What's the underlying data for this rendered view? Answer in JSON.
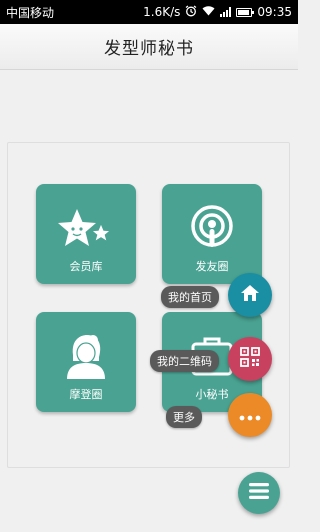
{
  "status_bar": {
    "carrier": "中国移动",
    "speed": "1.6K/s",
    "time": "09:35",
    "icons": [
      "alarm-icon",
      "wifi-icon",
      "signal-icon",
      "battery-icon"
    ]
  },
  "title_bar": {
    "title": "发型师秘书"
  },
  "tiles": [
    {
      "label": "会员库",
      "icon": "stars-icon"
    },
    {
      "label": "发友圈",
      "icon": "podcast-icon"
    },
    {
      "label": "摩登圈",
      "icon": "woman-icon"
    },
    {
      "label": "小秘书",
      "icon": "briefcase-icon"
    }
  ],
  "menu": {
    "home_label": "我的首页",
    "qr_label": "我的二维码",
    "more_label": "更多",
    "home_icon": "home-icon",
    "qr_icon": "qr-code-icon",
    "more_icon": "more-dots-icon",
    "main_icon": "menu-icon"
  },
  "colors": {
    "tile": "#4aa392",
    "home_button": "#1a8ea3",
    "qr_button": "#c8425f",
    "more_button": "#ec8a27",
    "menu_button": "#4aa392"
  }
}
